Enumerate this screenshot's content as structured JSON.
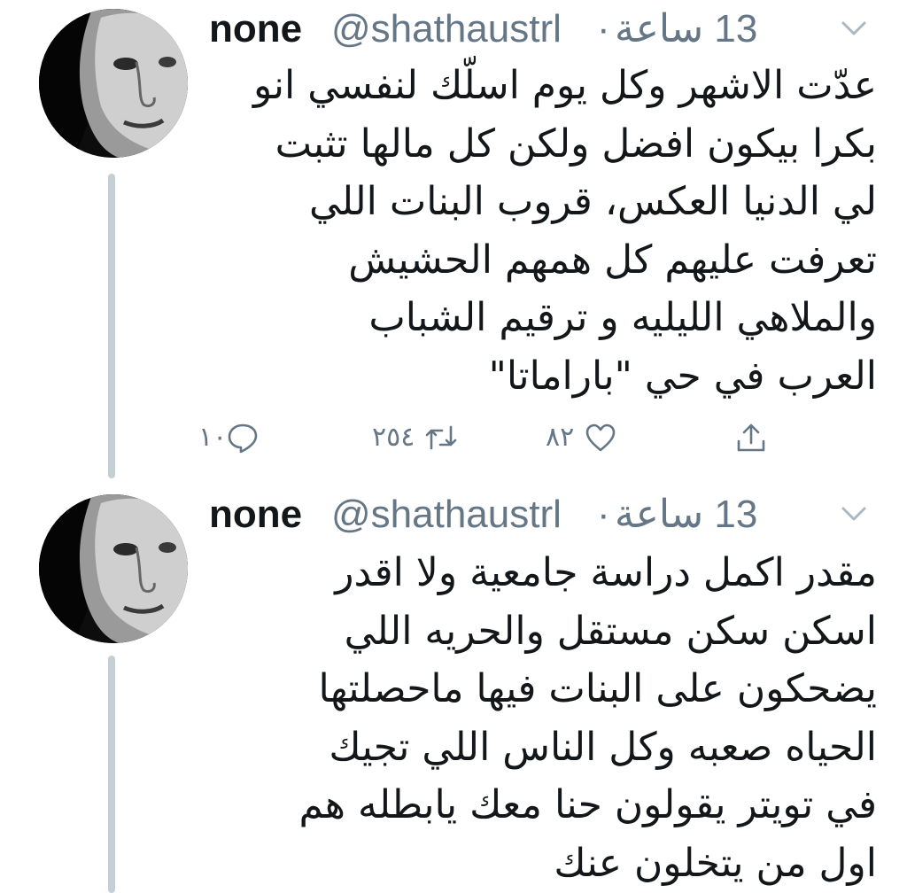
{
  "tweets": [
    {
      "name": "none",
      "handle": "@shathaustrl",
      "separator": "·",
      "time": "13 ساعة",
      "text": "عدّت الاشهر وكل يوم اسلّك لنفسي انو\nبكرا بيكون افضل ولكن كل مالها تثبت\nلي الدنيا العكس، قروب البنات اللي\nتعرفت عليهم كل همهم الحشيش\nوالملاهي الليليه و ترقيم الشباب\nالعرب في حي \"باراماتا\"",
      "replies": "١٠",
      "retweets": "٢٥٤",
      "likes": "٨٢"
    },
    {
      "name": "none",
      "handle": "@shathaustrl",
      "separator": "·",
      "time": "13 ساعة",
      "text": "مقدر اكمل دراسة جامعية ولا اقدر\nاسكن سكن مستقل والحريه اللي\nيضحكون على البنات فيها ماحصلتها\nالحياه صعبه وكل الناس اللي تجيك\nفي تويتر يقولون حنا معك يابطله هم\nاول من يتخلون عنك"
    }
  ],
  "icons": {
    "reply": "reply-icon",
    "retweet": "retweet-icon",
    "like": "heart-icon",
    "share": "share-icon",
    "menu": "chevron-down-icon"
  },
  "colors": {
    "text": "#14171a",
    "secondary": "#657786",
    "thread_line": "#c4cfd6"
  }
}
